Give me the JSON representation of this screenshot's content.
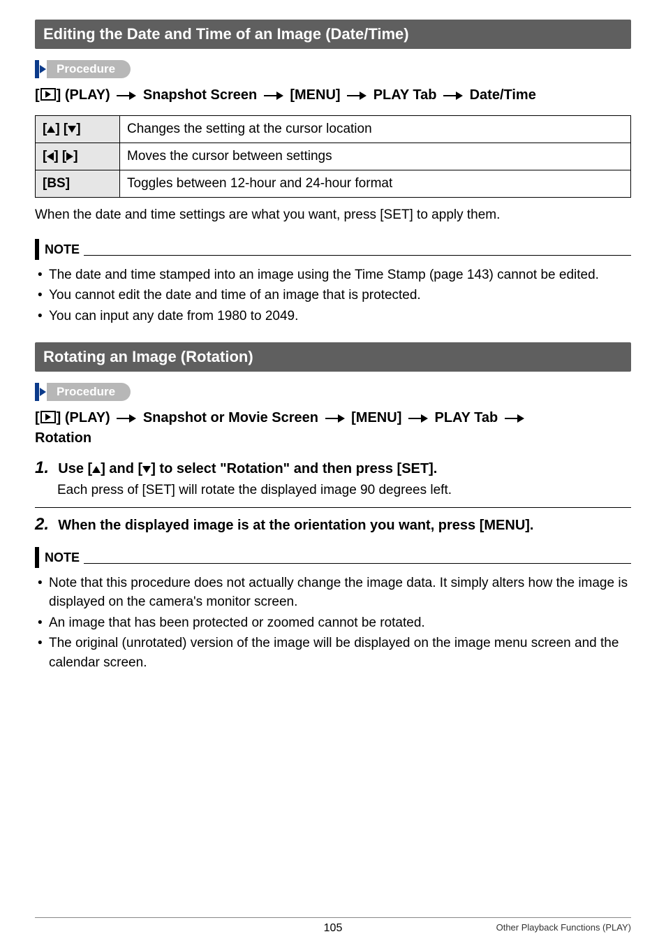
{
  "section1": {
    "title": "Editing the Date and Time of an Image (Date/Time)",
    "procedure_label": "Procedure",
    "path_prefix": "[",
    "path_play": "] (PLAY)",
    "path_seg1": "Snapshot Screen",
    "path_seg2": "[MENU]",
    "path_seg3": "PLAY Tab",
    "path_seg4": "Date/Time",
    "table": {
      "r0_key_open": "[",
      "r0_key_mid": "] [",
      "r0_key_close": "]",
      "r0_val": "Changes the setting at the cursor location",
      "r1_key_open": "[",
      "r1_key_mid": "] [",
      "r1_key_close": "]",
      "r1_val": "Moves the cursor between settings",
      "r2_key": "[BS]",
      "r2_val": "Toggles between 12-hour and 24-hour format"
    },
    "after_table": "When the date and time settings are what you want, press [SET] to apply them.",
    "note_label": "NOTE",
    "notes": [
      "The date and time stamped into an image using the Time Stamp (page 143) cannot be edited.",
      "You cannot edit the date and time of an image that is protected.",
      "You can input any date from 1980 to 2049."
    ]
  },
  "section2": {
    "title": "Rotating an Image (Rotation)",
    "procedure_label": "Procedure",
    "path_prefix": "[",
    "path_play": "] (PLAY)",
    "path_seg1": "Snapshot or Movie Screen",
    "path_seg2": "[MENU]",
    "path_seg3": "PLAY Tab",
    "path_seg4": "Rotation",
    "step1_num": "1.",
    "step1_head_a": "Use [",
    "step1_head_b": "] and [",
    "step1_head_c": "] to select \"Rotation\" and then press [SET].",
    "step1_sub": "Each press of [SET] will rotate the displayed image 90 degrees left.",
    "step2_num": "2.",
    "step2_head": "When the displayed image is at the orientation you want, press [MENU].",
    "note_label": "NOTE",
    "notes": [
      "Note that this procedure does not actually change the image data. It simply alters how the image is displayed on the camera's monitor screen.",
      "An image that has been protected or zoomed cannot be rotated.",
      "The original (unrotated) version of the image will be displayed on the image menu screen and the calendar screen."
    ]
  },
  "footer": {
    "page": "105",
    "right": "Other Playback Functions (PLAY)"
  }
}
